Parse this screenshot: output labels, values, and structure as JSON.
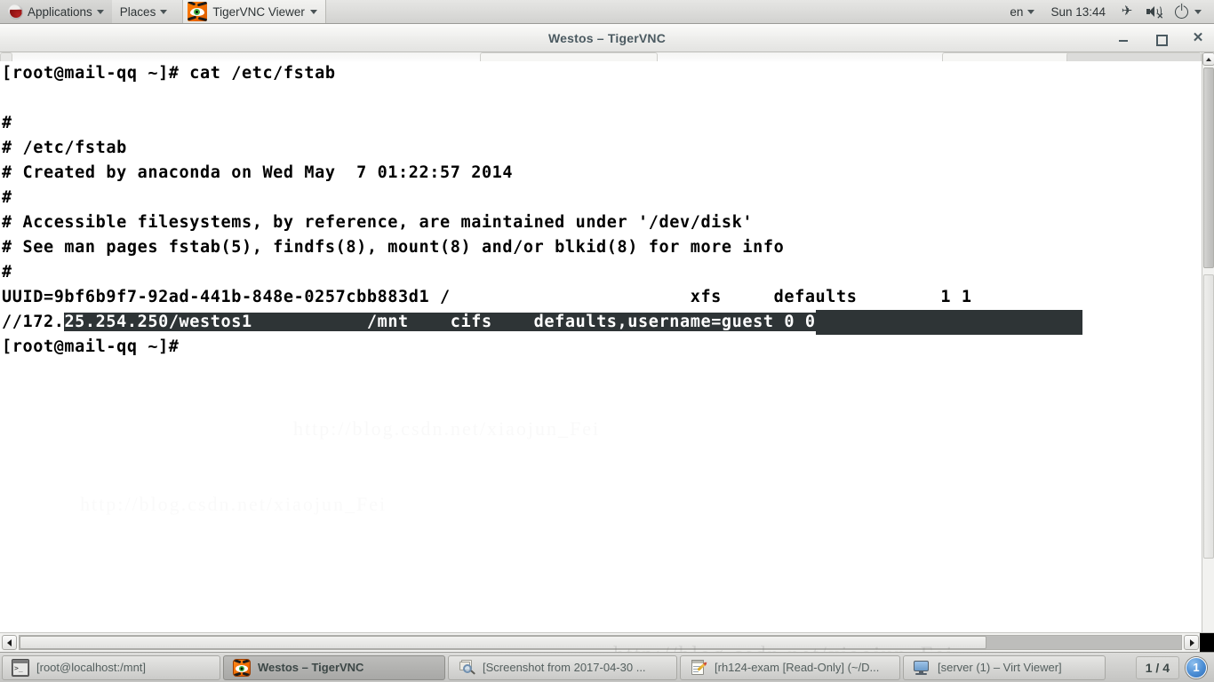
{
  "top_panel": {
    "applications_label": "Applications",
    "places_label": "Places",
    "window_button_label": "TigerVNC Viewer",
    "window_button_icon": "tiger-icon",
    "keyboard_layout": "en",
    "clock": "Sun 13:44",
    "indicators": [
      {
        "name": "airplane-mode-icon",
        "glyph": "✈"
      },
      {
        "name": "volume-muted-icon",
        "glyph": ""
      },
      {
        "name": "power-icon",
        "glyph": ""
      }
    ]
  },
  "window": {
    "title": "Westos – TigerVNC",
    "controls": {
      "minimize": "–",
      "maximize": "□",
      "close": "✕"
    }
  },
  "terminal": {
    "lines": [
      {
        "text": "[root@mail-qq ~]# cat /etc/fstab",
        "selected": false
      },
      {
        "text": "",
        "selected": false
      },
      {
        "text": "#",
        "selected": false
      },
      {
        "text": "# /etc/fstab",
        "selected": false
      },
      {
        "text": "# Created by anaconda on Wed May  7 01:22:57 2014",
        "selected": false
      },
      {
        "text": "#",
        "selected": false
      },
      {
        "text": "# Accessible filesystems, by reference, are maintained under '/dev/disk'",
        "selected": false
      },
      {
        "text": "# See man pages fstab(5), findfs(8), mount(8) and/or blkid(8) for more info",
        "selected": false
      },
      {
        "text": "#",
        "selected": false
      },
      {
        "text": "UUID=9bf6b9f7-92ad-441b-848e-0257cbb883d1 /                       xfs     defaults        1 1",
        "selected": false
      }
    ],
    "selected_line": {
      "prefix": "//172.",
      "selected_text": "25.254.250/westos1           /mnt    cifs    defaults,username=guest 0 0"
    },
    "prompt_line": "[root@mail-qq ~]#"
  },
  "taskbar": {
    "buttons": [
      {
        "label": "[root@localhost:/mnt]",
        "icon": "terminal-icon",
        "active": false
      },
      {
        "label": "Westos – TigerVNC",
        "icon": "tiger-icon",
        "active": true
      },
      {
        "label": "[Screenshot from 2017-04-30 ...",
        "icon": "screenshot-icon",
        "active": false
      },
      {
        "label": "[rh124-exam [Read-Only] (~/D...",
        "icon": "text-editor-icon",
        "active": false
      },
      {
        "label": "[server (1) – Virt Viewer]",
        "icon": "monitor-icon",
        "active": false
      }
    ],
    "workspace_count": "1 / 4",
    "workspace_badge": "1"
  },
  "watermark": {
    "text": "http://blog.csdn.net/xiaojun_Fei"
  },
  "colors": {
    "panel_bg": "#dcdcda",
    "titlebar_bg": "#ededeb",
    "terminal_bg": "#ffffff",
    "terminal_fg": "#000000",
    "selection_bg": "#2e3436",
    "selection_fg": "#ffffff",
    "taskbar_bg": "#d0d0ce",
    "accent_blue": "#4b8dd4",
    "tiger_orange": "#ef6c00"
  }
}
